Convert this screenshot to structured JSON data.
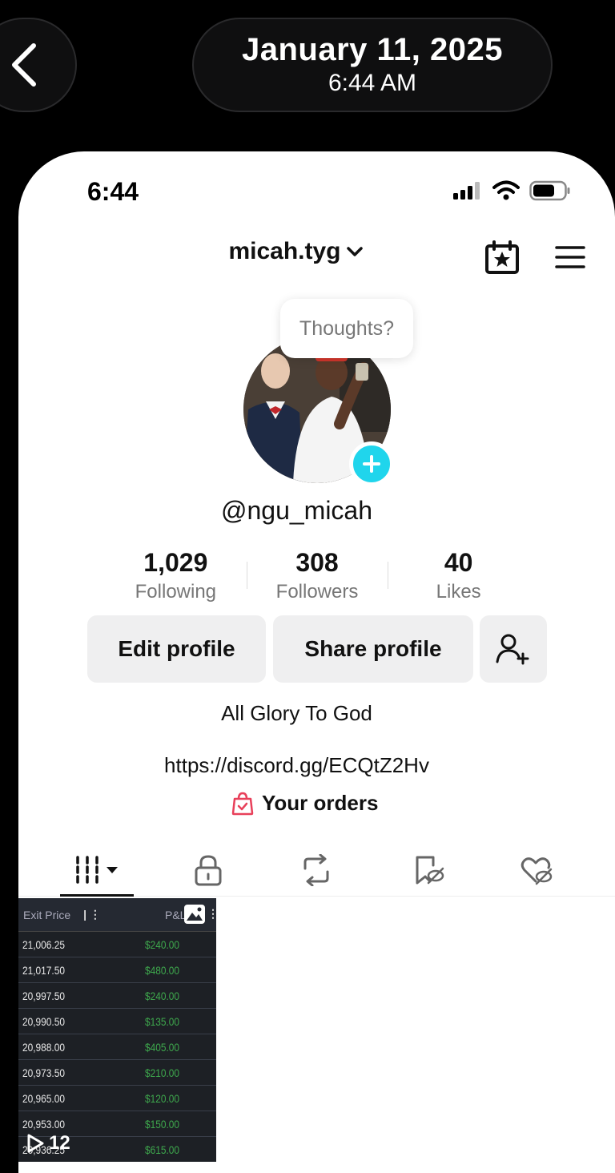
{
  "overlay": {
    "date": "January 11, 2025",
    "time": "6:44 AM"
  },
  "status_bar": {
    "time": "6:44"
  },
  "profile": {
    "username": "micah.tyg",
    "thoughts_bubble": "Thoughts?",
    "handle": "@ngu_micah",
    "stats": [
      {
        "value": "1,029",
        "label": "Following"
      },
      {
        "value": "308",
        "label": "Followers"
      },
      {
        "value": "40",
        "label": "Likes"
      }
    ],
    "edit_label": "Edit profile",
    "share_label": "Share profile",
    "bio": "All Glory To God",
    "link": "https://discord.gg/ECQtZ2Hv",
    "orders_label": "Your orders"
  },
  "colors": {
    "accent_cyan": "#20d5ec",
    "orders_pink": "#e8405a",
    "pnl_green": "#3ea84d"
  },
  "video": {
    "header_left": "Exit Price",
    "header_right": "P&L",
    "rows": [
      {
        "exit": "21,006.25",
        "pnl": "$240.00"
      },
      {
        "exit": "21,017.50",
        "pnl": "$480.00"
      },
      {
        "exit": "20,997.50",
        "pnl": "$240.00"
      },
      {
        "exit": "20,990.50",
        "pnl": "$135.00"
      },
      {
        "exit": "20,988.00",
        "pnl": "$405.00"
      },
      {
        "exit": "20,973.50",
        "pnl": "$210.00"
      },
      {
        "exit": "20,965.00",
        "pnl": "$120.00"
      },
      {
        "exit": "20,953.00",
        "pnl": "$150.00"
      },
      {
        "exit": "20,936.25",
        "pnl": "$615.00"
      }
    ],
    "views": "12"
  }
}
